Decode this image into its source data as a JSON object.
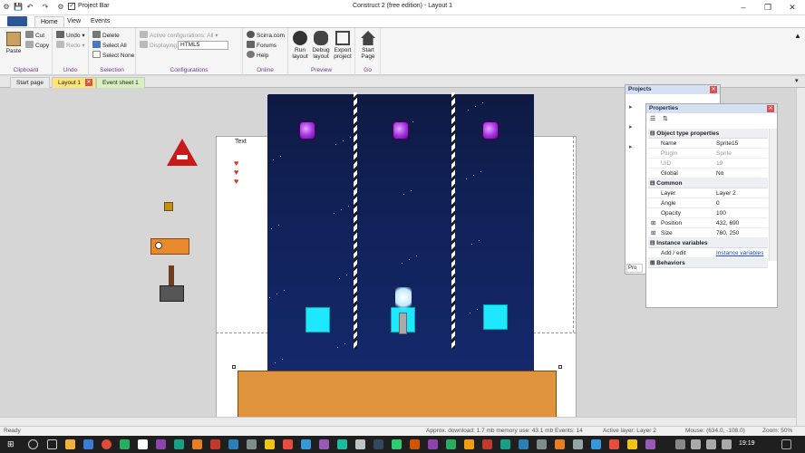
{
  "window": {
    "title": "Construct 2 (free edition) - Layout 1",
    "quick_access_label": "Project Bar",
    "controls": [
      "–",
      "❐",
      "✕"
    ]
  },
  "ribbon_tabs": [
    "Home",
    "View",
    "Events"
  ],
  "ribbon": {
    "clipboard": {
      "paste": "Paste",
      "cut": "Cut",
      "copy": "Copy",
      "label": "Clipboard"
    },
    "undo": {
      "undo": "Undo",
      "redo": "Redo",
      "label": "Undo"
    },
    "selection": {
      "delete": "Delete",
      "select_all": "Select All",
      "select_none": "Select None",
      "label": "Selection"
    },
    "configurations": {
      "active": "Active configurations: All",
      "displaying_label": "Displaying:",
      "displaying_value": "HTML5",
      "label": "Configurations"
    },
    "online": {
      "scirra": "Scirra.com",
      "forums": "Forums",
      "help": "Help",
      "label": "Online"
    },
    "preview": {
      "run": "Run layout",
      "run2": "layout",
      "run1": "Run",
      "debug1": "Debug",
      "debug2": "layout",
      "export1": "Export",
      "export2": "project",
      "label": "Preview"
    },
    "go": {
      "start1": "Start",
      "start2": "Page",
      "label": "Go"
    }
  },
  "doc_tabs": [
    "Start page",
    "Layout 1",
    "Event sheet 1"
  ],
  "canvas": {
    "text_object": "Text",
    "colors": {
      "sky": "#112157",
      "gem": "#a52ee0",
      "block": "#1ee8ff",
      "floor": "#e0943c"
    }
  },
  "projects_panel": {
    "title": "Projects",
    "tab_label": "Pro"
  },
  "properties_panel": {
    "title": "Properties",
    "sections": [
      {
        "name": "Object type properties",
        "rows": [
          {
            "key": "Name",
            "value": "Sprite15"
          },
          {
            "key": "Plugin",
            "value": "Sprite"
          },
          {
            "key": "UID",
            "value": "19"
          },
          {
            "key": "Global",
            "value": "No"
          }
        ]
      },
      {
        "name": "Common",
        "rows": [
          {
            "key": "Layer",
            "value": "Layer 2"
          },
          {
            "key": "Angle",
            "value": "0"
          },
          {
            "key": "Opacity",
            "value": "100"
          },
          {
            "key": "Position",
            "value": "432, 690"
          },
          {
            "key": "Size",
            "value": "760, 250"
          }
        ]
      },
      {
        "name": "Instance variables",
        "rows": [
          {
            "key": "Add / edit",
            "value": "Instance variables"
          }
        ]
      },
      {
        "name": "Behaviors",
        "rows": []
      }
    ]
  },
  "status_bar": {
    "ready": "Ready",
    "download": "Approx. download: 1.7 mb  memory use: 43.1 mb  Events: 14",
    "layer": "Active layer: Layer 2",
    "mouse": "Mouse: (634.0, -108.0)",
    "zoom": "Zoom: 50%"
  },
  "taskbar": {
    "time": "19:19"
  }
}
